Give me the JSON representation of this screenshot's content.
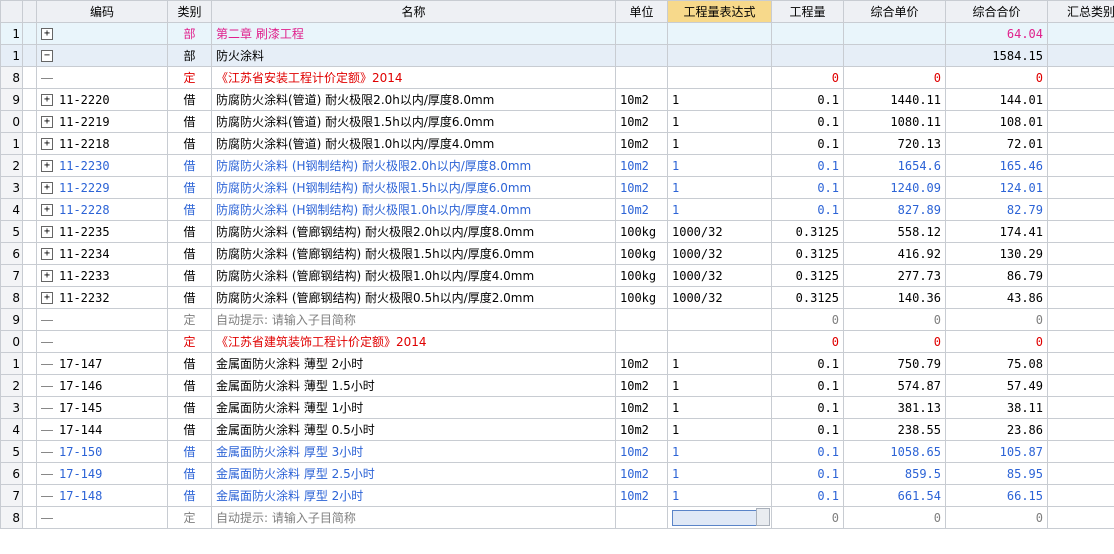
{
  "columns": [
    "",
    "",
    "编码",
    "类别",
    "名称",
    "单位",
    "工程量表达式",
    "工程量",
    "综合单价",
    "综合合价",
    "汇总类别"
  ],
  "rows": [
    {
      "rn": "1",
      "tree": "plus",
      "code": "",
      "cat": "部",
      "name": "第二章    刷漆工程",
      "unit": "",
      "expr": "",
      "qty": "",
      "price": "",
      "total": "64.04",
      "color": "pink",
      "cls": "hdr"
    },
    {
      "rn": "1",
      "tree": "minus",
      "code": "",
      "cat": "部",
      "name": "防火涂料",
      "unit": "",
      "expr": "",
      "qty": "",
      "price": "",
      "total": "1584.15",
      "color": "black",
      "cls": "sel"
    },
    {
      "rn": "8",
      "tree": "line",
      "code": "",
      "cat": "定",
      "name": "《江苏省安装工程计价定额》2014",
      "unit": "",
      "expr": "",
      "qty": "0",
      "price": "0",
      "total": "0",
      "color": "red",
      "cls": ""
    },
    {
      "rn": "9",
      "tree": "plus",
      "code": "11-2220",
      "cat": "借",
      "name": "防腐防火涂料(管道) 耐火极限2.0h以内/厚度8.0mm",
      "unit": "10m2",
      "expr": "1",
      "qty": "0.1",
      "price": "1440.11",
      "total": "144.01",
      "color": "black",
      "cls": ""
    },
    {
      "rn": "0",
      "tree": "plus",
      "code": "11-2219",
      "cat": "借",
      "name": "防腐防火涂料(管道) 耐火极限1.5h以内/厚度6.0mm",
      "unit": "10m2",
      "expr": "1",
      "qty": "0.1",
      "price": "1080.11",
      "total": "108.01",
      "color": "black",
      "cls": ""
    },
    {
      "rn": "1",
      "tree": "plus",
      "code": "11-2218",
      "cat": "借",
      "name": "防腐防火涂料(管道) 耐火极限1.0h以内/厚度4.0mm",
      "unit": "10m2",
      "expr": "1",
      "qty": "0.1",
      "price": "720.13",
      "total": "72.01",
      "color": "black",
      "cls": ""
    },
    {
      "rn": "2",
      "tree": "plus",
      "code": "11-2230",
      "cat": "借",
      "name": "防腐防火涂料 (H钢制结构) 耐火极限2.0h以内/厚度8.0mm",
      "unit": "10m2",
      "expr": "1",
      "qty": "0.1",
      "price": "1654.6",
      "total": "165.46",
      "color": "blue",
      "cls": ""
    },
    {
      "rn": "3",
      "tree": "plus",
      "code": "11-2229",
      "cat": "借",
      "name": "防腐防火涂料 (H钢制结构) 耐火极限1.5h以内/厚度6.0mm",
      "unit": "10m2",
      "expr": "1",
      "qty": "0.1",
      "price": "1240.09",
      "total": "124.01",
      "color": "blue",
      "cls": ""
    },
    {
      "rn": "4",
      "tree": "plus",
      "code": "11-2228",
      "cat": "借",
      "name": "防腐防火涂料 (H钢制结构) 耐火极限1.0h以内/厚度4.0mm",
      "unit": "10m2",
      "expr": "1",
      "qty": "0.1",
      "price": "827.89",
      "total": "82.79",
      "color": "blue",
      "cls": ""
    },
    {
      "rn": "5",
      "tree": "plus",
      "code": "11-2235",
      "cat": "借",
      "name": "防腐防火涂料 (管廊钢结构) 耐火极限2.0h以内/厚度8.0mm",
      "unit": "100kg",
      "expr": "1000/32",
      "qty": "0.3125",
      "price": "558.12",
      "total": "174.41",
      "color": "black",
      "cls": ""
    },
    {
      "rn": "6",
      "tree": "plus",
      "code": "11-2234",
      "cat": "借",
      "name": "防腐防火涂料 (管廊钢结构) 耐火极限1.5h以内/厚度6.0mm",
      "unit": "100kg",
      "expr": "1000/32",
      "qty": "0.3125",
      "price": "416.92",
      "total": "130.29",
      "color": "black",
      "cls": ""
    },
    {
      "rn": "7",
      "tree": "plus",
      "code": "11-2233",
      "cat": "借",
      "name": "防腐防火涂料 (管廊钢结构) 耐火极限1.0h以内/厚度4.0mm",
      "unit": "100kg",
      "expr": "1000/32",
      "qty": "0.3125",
      "price": "277.73",
      "total": "86.79",
      "color": "black",
      "cls": ""
    },
    {
      "rn": "8",
      "tree": "plus",
      "code": "11-2232",
      "cat": "借",
      "name": "防腐防火涂料 (管廊钢结构) 耐火极限0.5h以内/厚度2.0mm",
      "unit": "100kg",
      "expr": "1000/32",
      "qty": "0.3125",
      "price": "140.36",
      "total": "43.86",
      "color": "black",
      "cls": ""
    },
    {
      "rn": "9",
      "tree": "line",
      "code": "",
      "cat": "定",
      "name": "自动提示: 请输入子目简称",
      "unit": "",
      "expr": "",
      "qty": "0",
      "price": "0",
      "total": "0",
      "color": "gray",
      "cls": ""
    },
    {
      "rn": "0",
      "tree": "line",
      "code": "",
      "cat": "定",
      "name": "《江苏省建筑装饰工程计价定额》2014",
      "unit": "",
      "expr": "",
      "qty": "0",
      "price": "0",
      "total": "0",
      "color": "red",
      "cls": ""
    },
    {
      "rn": "1",
      "tree": "line",
      "code": "17-147",
      "cat": "借",
      "name": "金属面防火涂料 薄型 2小时",
      "unit": "10m2",
      "expr": "1",
      "qty": "0.1",
      "price": "750.79",
      "total": "75.08",
      "color": "black",
      "cls": ""
    },
    {
      "rn": "2",
      "tree": "line",
      "code": "17-146",
      "cat": "借",
      "name": "金属面防火涂料 薄型 1.5小时",
      "unit": "10m2",
      "expr": "1",
      "qty": "0.1",
      "price": "574.87",
      "total": "57.49",
      "color": "black",
      "cls": ""
    },
    {
      "rn": "3",
      "tree": "line",
      "code": "17-145",
      "cat": "借",
      "name": "金属面防火涂料 薄型 1小时",
      "unit": "10m2",
      "expr": "1",
      "qty": "0.1",
      "price": "381.13",
      "total": "38.11",
      "color": "black",
      "cls": ""
    },
    {
      "rn": "4",
      "tree": "line",
      "code": "17-144",
      "cat": "借",
      "name": "金属面防火涂料 薄型 0.5小时",
      "unit": "10m2",
      "expr": "1",
      "qty": "0.1",
      "price": "238.55",
      "total": "23.86",
      "color": "black",
      "cls": ""
    },
    {
      "rn": "5",
      "tree": "line",
      "code": "17-150",
      "cat": "借",
      "name": "金属面防火涂料 厚型 3小时",
      "unit": "10m2",
      "expr": "1",
      "qty": "0.1",
      "price": "1058.65",
      "total": "105.87",
      "color": "blue",
      "cls": ""
    },
    {
      "rn": "6",
      "tree": "line",
      "code": "17-149",
      "cat": "借",
      "name": "金属面防火涂料 厚型 2.5小时",
      "unit": "10m2",
      "expr": "1",
      "qty": "0.1",
      "price": "859.5",
      "total": "85.95",
      "color": "blue",
      "cls": ""
    },
    {
      "rn": "7",
      "tree": "line",
      "code": "17-148",
      "cat": "借",
      "name": "金属面防火涂料 厚型 2小时",
      "unit": "10m2",
      "expr": "1",
      "qty": "0.1",
      "price": "661.54",
      "total": "66.15",
      "color": "blue",
      "cls": ""
    },
    {
      "rn": "8",
      "tree": "line",
      "code": "",
      "cat": "定",
      "name": "自动提示: 请输入子目简称",
      "unit": "",
      "expr": "",
      "qty": "0",
      "price": "0",
      "total": "0",
      "color": "gray",
      "cls": "edit"
    }
  ],
  "colors": {
    "pink": "#e0208c",
    "red": "#e00000",
    "blue": "#2c63d6",
    "gray": "#808080",
    "header_highlight": "#f7d98b"
  }
}
